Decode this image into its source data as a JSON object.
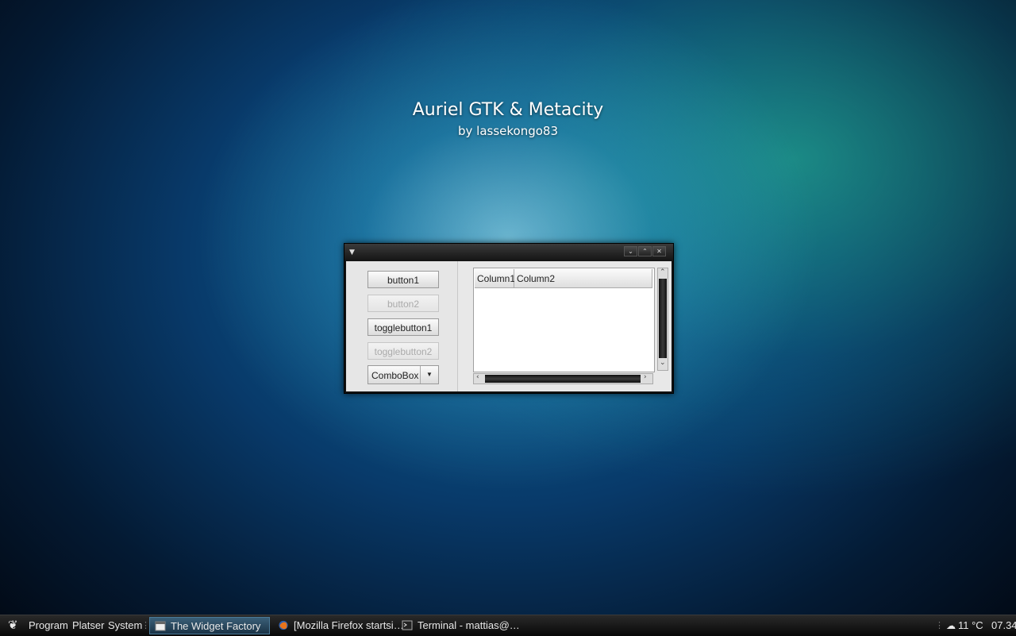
{
  "wallpaper": {
    "title": "Auriel GTK & Metacity",
    "subtitle": "by lassekongo83"
  },
  "window": {
    "menu_icon": "menu-arrow-icon",
    "controls": [
      "minimize-icon",
      "maximize-icon",
      "close-icon"
    ],
    "buttons": {
      "button1": "button1",
      "button2": "button2",
      "togglebutton1": "togglebutton1",
      "togglebutton2": "togglebutton2"
    },
    "combo": {
      "value": "ComboBox"
    },
    "tree": {
      "columns": [
        "Column1",
        "Column2"
      ],
      "rows": []
    }
  },
  "taskbar": {
    "menus": [
      "Program",
      "Platser",
      "System"
    ],
    "tasks": [
      {
        "label": "The Widget Factory",
        "active": true
      },
      {
        "label": "[Mozilla Firefox startsi…",
        "active": false
      },
      {
        "label": "Terminal - mattias@…",
        "active": false
      }
    ],
    "weather": "11 °C",
    "clock": "07.34"
  },
  "colors": {
    "accent": "#3b5f78",
    "window_bg": "#e8e8e8",
    "titlebar": "#141414"
  }
}
